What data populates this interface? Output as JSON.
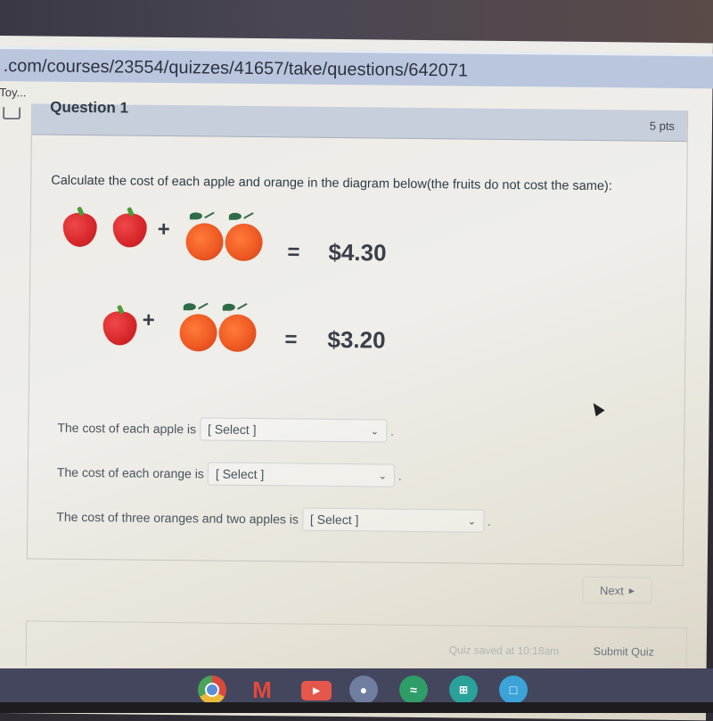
{
  "browser": {
    "url": ".com/courses/23554/quizzes/41657/take/questions/642071",
    "bookmark": "Toy..."
  },
  "question": {
    "title": "Question 1",
    "points": "5 pts",
    "prompt": "Calculate the cost of each apple and orange in the diagram below(the fruits do not cost the same):",
    "diagram": {
      "equations": [
        {
          "apples": 2,
          "oranges": 2,
          "plus": "+",
          "equals": "=",
          "total": "$4.30"
        },
        {
          "apples": 1,
          "oranges": 2,
          "plus": "+",
          "equals": "=",
          "total": "$3.20"
        }
      ]
    },
    "answers": [
      {
        "label": "The cost of each apple is",
        "selected": "[ Select ]"
      },
      {
        "label": "The cost of each orange is",
        "selected": "[ Select ]"
      },
      {
        "label": "The cost of three oranges and two apples is",
        "selected": "[ Select ]"
      }
    ]
  },
  "nav": {
    "next_label": "Next",
    "next_icon": "triangle-right"
  },
  "footer": {
    "saved_status": "Quiz saved at 10:18am",
    "submit_label": "Submit Quiz"
  },
  "shelf": {
    "apps": [
      {
        "name": "chrome",
        "color": "#e8a23a"
      },
      {
        "name": "gmail",
        "color": "#e5493b"
      },
      {
        "name": "youtube",
        "color": "#e4574a"
      },
      {
        "name": "camera",
        "color": "#6f7ea0"
      },
      {
        "name": "spotify",
        "color": "#2f9d68"
      },
      {
        "name": "calculator",
        "color": "#2aa29a"
      },
      {
        "name": "files",
        "color": "#3ba3d8"
      }
    ]
  }
}
